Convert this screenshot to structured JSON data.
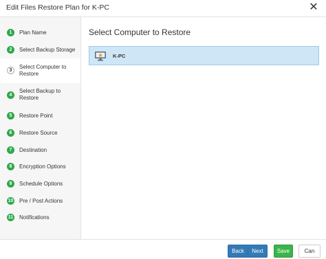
{
  "window": {
    "title": "Edit Files Restore Plan for K-PC",
    "close_icon": "close-icon"
  },
  "sidebar": {
    "steps": [
      {
        "num": "1",
        "label": "Plan Name"
      },
      {
        "num": "2",
        "label": "Select Backup Storage"
      },
      {
        "num": "3",
        "label": "Select Computer to Restore",
        "active": true
      },
      {
        "num": "4",
        "label": "Select Backup to Restore"
      },
      {
        "num": "5",
        "label": "Restore Point"
      },
      {
        "num": "6",
        "label": "Restore Source"
      },
      {
        "num": "7",
        "label": "Destination"
      },
      {
        "num": "8",
        "label": "Encryption Options"
      },
      {
        "num": "9",
        "label": "Schedule Options"
      },
      {
        "num": "10",
        "label": "Pre / Post Actions"
      },
      {
        "num": "11",
        "label": "Notifications"
      }
    ]
  },
  "main": {
    "title": "Select Computer to Restore",
    "computers": [
      {
        "name": "K-PC",
        "icon": "computer-icon",
        "selected": true
      }
    ]
  },
  "footer": {
    "back_label": "Back",
    "next_label": "Next",
    "save_label": "Save",
    "cancel_label": "Can"
  },
  "colors": {
    "step_badge": "#2ea84a",
    "selected_row": "#cfe6f6",
    "primary_button": "#337ab7",
    "save_button": "#39b54a"
  }
}
